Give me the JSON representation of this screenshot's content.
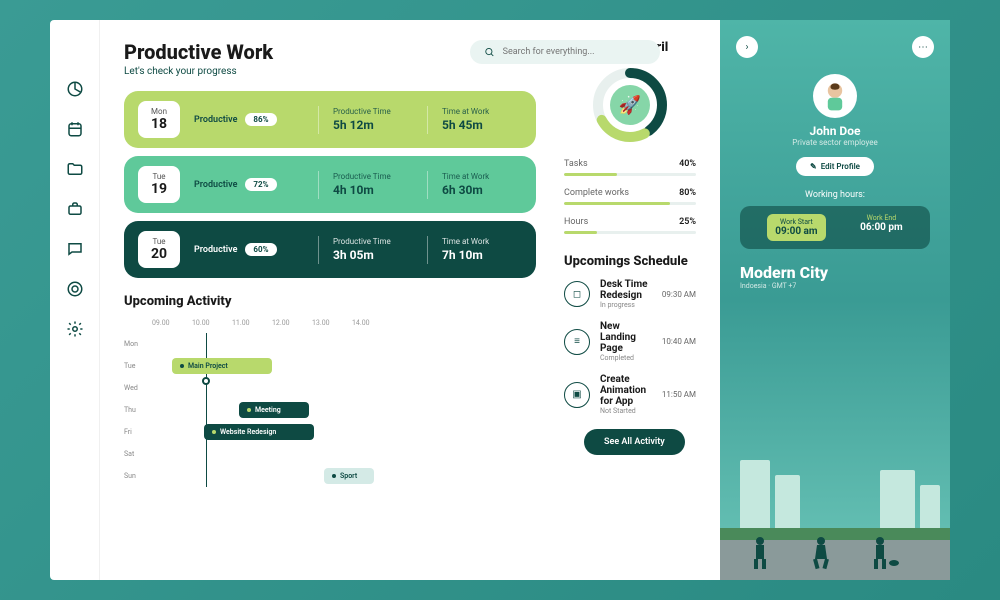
{
  "header": {
    "title": "Productive Work",
    "subtitle": "Let's check your progress",
    "searchPlaceholder": "Search for everything..."
  },
  "days": [
    {
      "day": "Mon",
      "date": "18",
      "label": "Productive",
      "pct": "86%",
      "prodTimeLabel": "Productive Time",
      "prodTime": "5h 12m",
      "workTimeLabel": "Time at Work",
      "workTime": "5h 45m"
    },
    {
      "day": "Tue",
      "date": "19",
      "label": "Productive",
      "pct": "72%",
      "prodTimeLabel": "Productive Time",
      "prodTime": "4h 10m",
      "workTimeLabel": "Time at Work",
      "workTime": "6h 30m"
    },
    {
      "day": "Tue",
      "date": "20",
      "label": "Productive",
      "pct": "60%",
      "prodTimeLabel": "Productive Time",
      "prodTime": "3h 05m",
      "workTimeLabel": "Time at Work",
      "workTime": "7h 10m"
    }
  ],
  "activity": {
    "title": "Upcoming Activity",
    "times": [
      "09.00",
      "10.00",
      "11.00",
      "12.00",
      "13.00",
      "14.00"
    ],
    "rows": [
      "Mon",
      "Tue",
      "Wed",
      "Thu",
      "Fri",
      "Sat",
      "Sun"
    ],
    "bars": {
      "mainProject": "Main Project",
      "meeting": "Meeting",
      "websiteRedesign": "Website Redesign",
      "sport": "Sport"
    }
  },
  "stats": {
    "title": "Statistics on April",
    "items": [
      {
        "label": "Tasks",
        "val": "40%",
        "pct": 40
      },
      {
        "label": "Complete works",
        "val": "80%",
        "pct": 80
      },
      {
        "label": "Hours",
        "val": "25%",
        "pct": 25
      }
    ]
  },
  "schedule": {
    "title": "Upcomings Schedule",
    "items": [
      {
        "title": "Desk Time Redesign",
        "status": "In progress",
        "time": "09:30 AM"
      },
      {
        "title": "New Landing Page",
        "status": "Completed",
        "time": "10:40 AM"
      },
      {
        "title": "Create Animation for App",
        "status": "Not Started",
        "time": "11:50 AM"
      }
    ],
    "seeAll": "See All Activity"
  },
  "profile": {
    "name": "John Doe",
    "role": "Private sector employee",
    "editLabel": "Edit Profile",
    "workHoursLabel": "Working hours:",
    "startLabel": "Work Start",
    "startVal": "09:00 am",
    "endLabel": "Work End",
    "endVal": "06:00 pm",
    "cityTitle": "Modern City",
    "citySub": "Indoesia · GMT +7"
  }
}
